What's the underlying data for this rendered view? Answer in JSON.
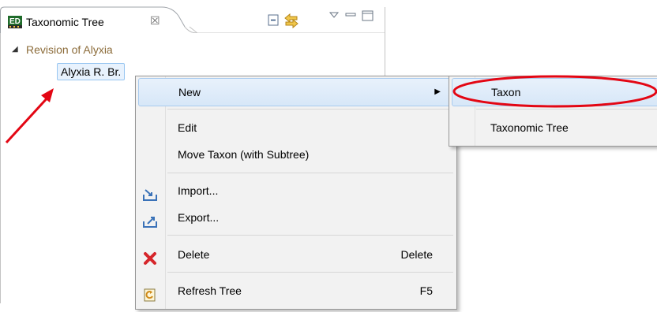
{
  "view": {
    "tab_title": "Taxonomic Tree",
    "tab_icon": "ed-view-icon",
    "close_glyph": "☒",
    "toolbar": [
      "collapse-all-icon",
      "link-with-editor-icon",
      "view-menu-icon",
      "minimize-icon",
      "maximize-icon"
    ]
  },
  "tree": {
    "root_label": "Revision of Alyxia",
    "selected_node": "Alyxia R. Br."
  },
  "context_menu": {
    "items": [
      {
        "label": "New",
        "icon": null,
        "shortcut": "",
        "submenu": true
      },
      {
        "label": "Edit",
        "icon": null,
        "shortcut": ""
      },
      {
        "label": "Move Taxon (with Subtree)",
        "icon": null,
        "shortcut": ""
      },
      {
        "label": "Import...",
        "icon": "import-icon",
        "shortcut": ""
      },
      {
        "label": "Export...",
        "icon": "export-icon",
        "shortcut": ""
      },
      {
        "label": "Delete",
        "icon": "delete-icon",
        "shortcut": "Delete"
      },
      {
        "label": "Refresh Tree",
        "icon": "refresh-icon",
        "shortcut": "F5"
      }
    ]
  },
  "submenu": {
    "items": [
      {
        "label": "Taxon",
        "highlighted": true
      },
      {
        "label": "Taxonomic Tree",
        "highlighted": false
      }
    ]
  },
  "colors": {
    "annotation_red": "#e30613",
    "root_label": "#8c6c3a",
    "selection_fill": "#e8f2fd",
    "menu_bg": "#f2f2f2"
  }
}
